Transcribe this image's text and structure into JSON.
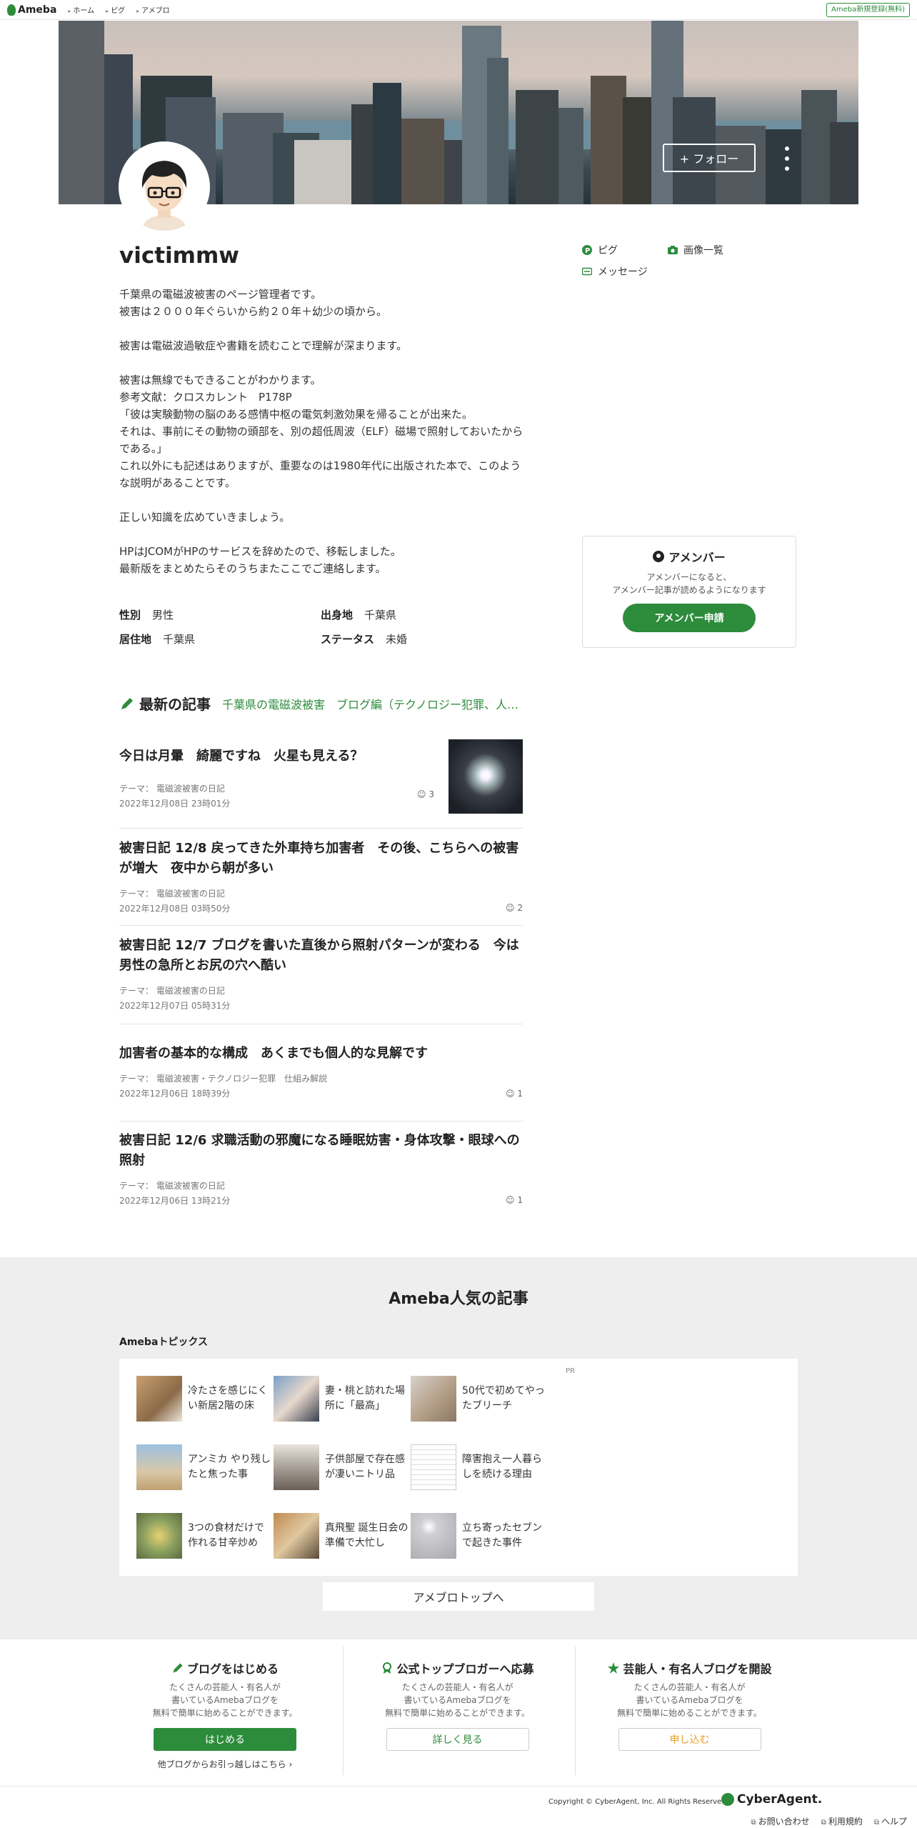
{
  "topnav": {
    "logo": "Ameba",
    "links": [
      "ホーム",
      "ピグ",
      "アメブロ"
    ],
    "signup": "Ameba新規登録(無料)"
  },
  "hero": {
    "follow": "+ フォロー"
  },
  "profile": {
    "name": "victimmw",
    "bio": "千葉県の電磁波被害のページ管理者です。\n被害は２０００年ぐらいから約２０年＋幼少の頃から。\n\n被害は電磁波過敏症や書籍を読むことで理解が深まります。\n\n被害は無線でもできることがわかります。\n参考文献：クロスカレント　P178P\n「彼は実験動物の脳のある感情中枢の電気刺激効果を帰ることが出来た。\nそれは、事前にその動物の頭部を、別の超低周波（ELF）磁場で照射しておいたからである。」\nこれ以外にも記述はありますが、重要なのは1980年代に出版された本で、このような説明があることです。\n\n正しい知識を広めていきましょう。\n\nHPはJCOMがHPのサービスを辞めたので、移転しました。\n最新版をまとめたらそのうちまたここでご連絡します。",
    "facts": [
      {
        "key": "性別",
        "value": "男性"
      },
      {
        "key": "出身地",
        "value": "千葉県"
      },
      {
        "key": "居住地",
        "value": "千葉県"
      },
      {
        "key": "ステータス",
        "value": "未婚"
      }
    ]
  },
  "side": {
    "pigg": "ピグ",
    "images": "画像一覧",
    "message": "メッセージ"
  },
  "member": {
    "title": "アメンバー",
    "desc": "アメンバーになると、\nアメンバー記事が読めるようになります",
    "button": "アメンバー申請"
  },
  "latest": {
    "title": "最新の記事",
    "categories": "千葉県の電磁波被害　ブログ編（テクノロジー犯罪、人…",
    "theme_label": "テーマ：",
    "articles": [
      {
        "title": "今日は月暈　綺麗ですね　火星も見える？",
        "theme": "電磁波被害の日記",
        "date": "2022年12月08日 23時01分",
        "comments": "3"
      },
      {
        "title": "被害日記 12/8 戻ってきた外車持ち加害者　その後、こちらへの被害が増大　夜中から朝が多い",
        "theme": "電磁波被害の日記",
        "date": "2022年12月08日 03時50分",
        "comments": "2"
      },
      {
        "title": "被害日記 12/7 ブログを書いた直後から照射パターンが変わる　今は男性の急所とお尻の穴へ酷い",
        "theme": "電磁波被害の日記",
        "date": "2022年12月07日 05時31分",
        "comments": ""
      },
      {
        "title": "加害者の基本的な構成　あくまでも個人的な見解です",
        "theme": "電磁波被害・テクノロジー犯罪　仕組み解説",
        "date": "2022年12月06日 18時39分",
        "comments": "1"
      },
      {
        "title": "被害日記 12/6 求職活動の邪魔になる睡眠妨害・身体攻撃・眼球への照射",
        "theme": "電磁波被害の日記",
        "date": "2022年12月06日 13時21分",
        "comments": "1"
      }
    ]
  },
  "popular": {
    "title": "Ameba人気の記事",
    "topics_label": "Amebaトピックス",
    "pr": "PR",
    "topics": [
      "冷たさを感じにくい新居2階の床",
      "妻・桃と訪れた場所に「最高」",
      "50代で初めてやったブリーチ",
      "アンミカ やり残したと焦った事",
      "子供部屋で存在感が凄いニトリ品",
      "障害抱え一人暮らしを続ける理由",
      "3つの食材だけで作れる甘辛炒め",
      "真飛聖 誕生日会の準備で大忙し",
      "立ち寄ったセブンで起きた事件"
    ],
    "top_button": "アメブロトップへ"
  },
  "promo": [
    {
      "title": "ブログをはじめる",
      "desc": "たくさんの芸能人・有名人が\n書いているAmebaブログを\n無料で簡単に始めることができます。",
      "button": "はじめる",
      "link": "他ブログからお引っ越しはこちら"
    },
    {
      "title": "公式トップブロガーへ応募",
      "desc": "たくさんの芸能人・有名人が\n書いているAmebaブログを\n無料で簡単に始めることができます。",
      "button": "詳しく見る"
    },
    {
      "title": "芸能人・有名人ブログを開設",
      "desc": "たくさんの芸能人・有名人が\n書いているAmebaブログを\n無料で簡単に始めることができます。",
      "button": "申し込む"
    }
  ],
  "footer": {
    "copyright": "Copyright © CyberAgent, Inc. All Rights Reserved.",
    "brand": "CyberAgent.",
    "links": [
      "お問い合わせ",
      "利用規約",
      "ヘルプ"
    ]
  },
  "colors": {
    "accent": "#2d8c3c",
    "orange": "#e6a02c"
  }
}
